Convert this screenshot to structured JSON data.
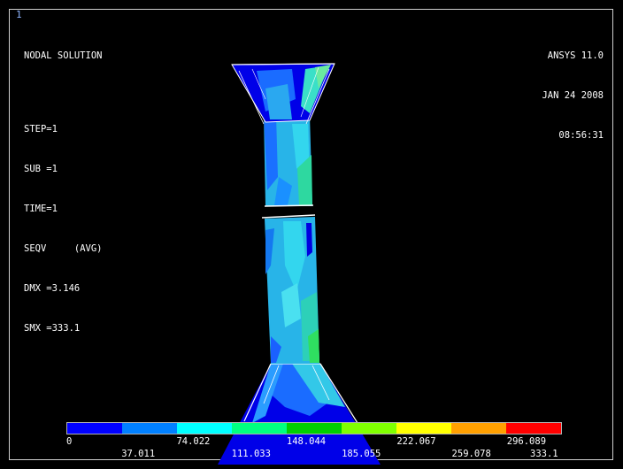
{
  "window_number": "1",
  "header_left": {
    "title": "NODAL SOLUTION",
    "lines": [
      "STEP=1",
      "SUB =1",
      "TIME=1",
      "SEQV     (AVG)",
      "DMX =3.146",
      "SMX =333.1"
    ]
  },
  "header_right": {
    "product": "ANSYS 11.0",
    "date": "JAN 24 2008",
    "time": "08:56:31"
  },
  "legend": {
    "colors": [
      "#0000ff",
      "#0080ff",
      "#00ffff",
      "#00ff80",
      "#00d000",
      "#80ff00",
      "#ffff00",
      "#ffa000",
      "#ff0000"
    ],
    "top_ticks": [
      "0",
      "74.022",
      "148.044",
      "222.067",
      "296.089"
    ],
    "bottom_ticks": [
      "37.011",
      "111.033",
      "185.055",
      "259.078",
      "333.1"
    ]
  }
}
